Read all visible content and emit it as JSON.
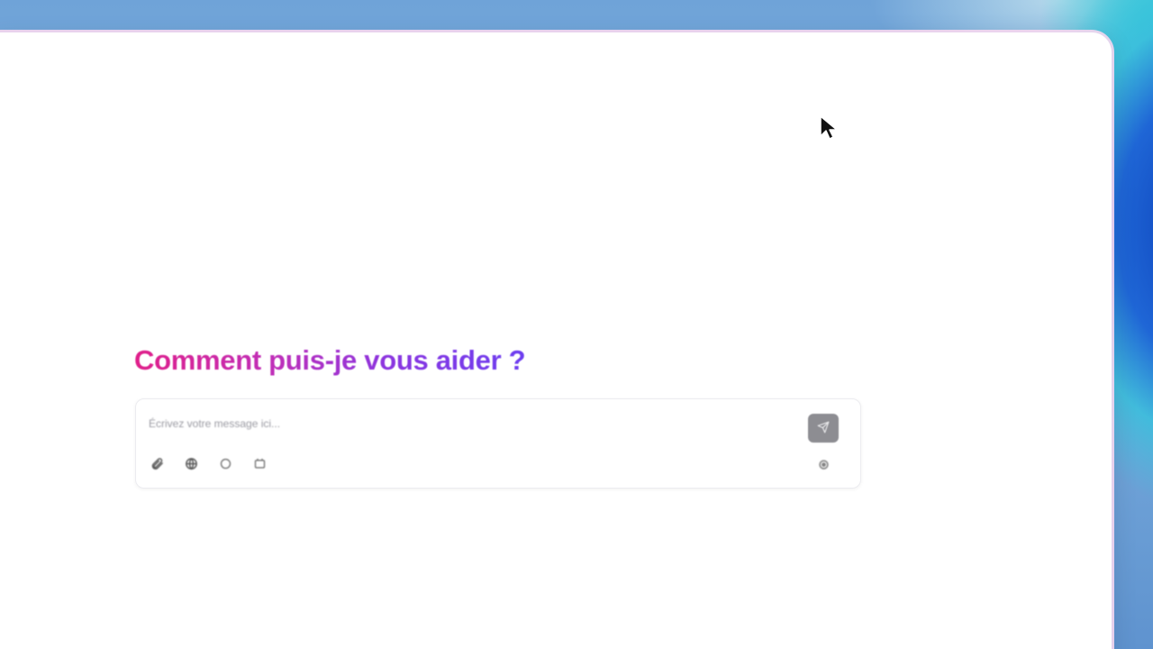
{
  "chat": {
    "heading": "Comment puis-je vous aider ?",
    "input_placeholder": "Écrivez votre message ici...",
    "input_value": "",
    "send_icon": "send-icon",
    "tools": [
      {
        "name": "attach",
        "icon": "paperclip-icon"
      },
      {
        "name": "web",
        "icon": "globe-icon"
      },
      {
        "name": "chat",
        "icon": "speech-bubble-icon"
      },
      {
        "name": "image",
        "icon": "image-icon"
      }
    ],
    "settings_icon": "settings-icon"
  },
  "colors": {
    "heading_start": "#e0208a",
    "heading_end": "#6d3ff0",
    "send_button": "#8d8d92"
  }
}
